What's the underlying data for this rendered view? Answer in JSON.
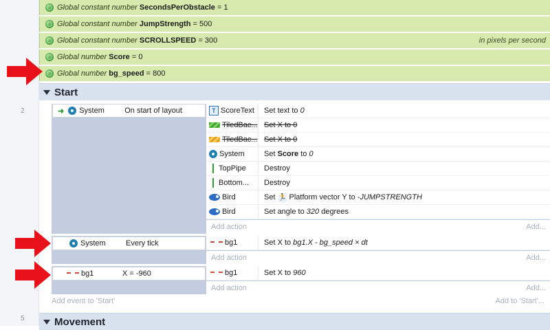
{
  "globals": [
    {
      "prefix": "Global constant number",
      "name": "SecondsPerObstacle",
      "value": "= 1",
      "comment": ""
    },
    {
      "prefix": "Global constant number",
      "name": "JumpStrength",
      "value": "= 500",
      "comment": ""
    },
    {
      "prefix": "Global constant number",
      "name": "SCROLLSPEED",
      "value": "= 300",
      "comment": "in pixels per second"
    },
    {
      "prefix": "Global number",
      "name": "Score",
      "value": "= 0",
      "comment": ""
    },
    {
      "prefix": "Global number",
      "name": "bg_speed",
      "value": "= 800",
      "comment": ""
    }
  ],
  "groups": {
    "start": {
      "title": "Start"
    },
    "movement": {
      "title": "Movement",
      "line": "5"
    }
  },
  "events": {
    "e1": {
      "line": "2",
      "cond_object": "System",
      "cond_text": "On start of layout",
      "actions": [
        {
          "object": "ScoreText",
          "pre": "Set text to",
          "em": "0",
          "post": ""
        },
        {
          "object": "TiledBac...",
          "pre": "Set X to 0",
          "em": "",
          "post": ""
        },
        {
          "object": "TiledBac...",
          "pre": "Set X to 0",
          "em": "",
          "post": ""
        },
        {
          "object": "System",
          "pre": "Set",
          "bold": "Score",
          "mid": "to",
          "em": "0"
        },
        {
          "object": "TopPipe",
          "pre": "Destroy"
        },
        {
          "object": "Bottom...",
          "pre": "Destroy"
        },
        {
          "object": "Bird",
          "pre": "Set",
          "beh": "Platform vector Y to",
          "em": "-JUMPSTRENGTH"
        },
        {
          "object": "Bird",
          "pre": "Set angle to",
          "em": "320",
          "post": "degrees"
        }
      ]
    },
    "e2": {
      "cond_object": "System",
      "cond_text": "Every tick",
      "action_object": "bg1",
      "action_pre": "Set X to",
      "action_em": "bg1.X - bg_speed × dt"
    },
    "e3": {
      "cond_object": "bg1",
      "cond_text": "X = -960",
      "action_object": "bg1",
      "action_pre": "Set X to",
      "action_em": "960"
    }
  },
  "labels": {
    "add_action": "Add action",
    "add_more": "Add...",
    "add_event": "Add event to 'Start'",
    "add_to": "Add to 'Start'..."
  },
  "colors": {
    "global_row": "#d7e9ad",
    "group_header": "#d9e2ef",
    "arrow": "#e8111a"
  }
}
